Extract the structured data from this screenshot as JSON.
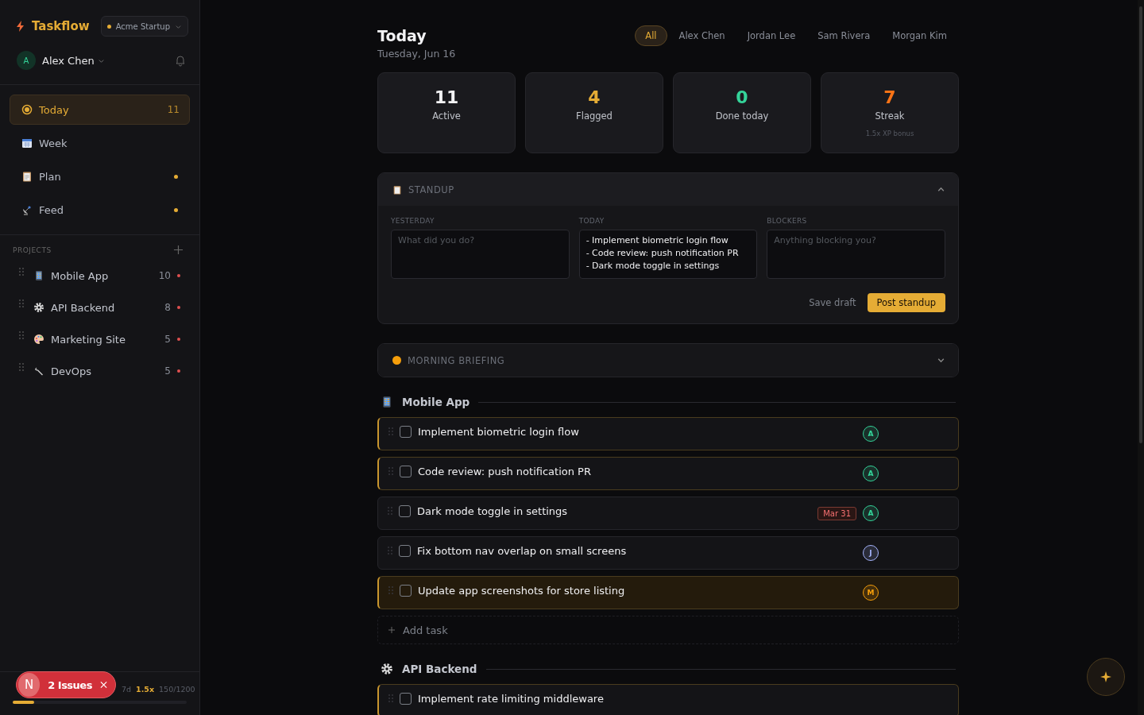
{
  "sidebar": {
    "app_name": "Taskflow",
    "workspace": {
      "name": "Acme Startup"
    },
    "user": {
      "initial": "A",
      "name": "Alex Chen"
    },
    "nav": [
      {
        "kind": "today",
        "label": "Today",
        "count": "11",
        "selected": true,
        "dot": false
      },
      {
        "kind": "week",
        "label": "Week",
        "selected": false,
        "dot": false
      },
      {
        "kind": "plan",
        "label": "Plan",
        "selected": false,
        "dot": true
      },
      {
        "kind": "feed",
        "label": "Feed",
        "selected": false,
        "dot": true
      }
    ],
    "projects_heading": "PROJECTS",
    "projects": [
      {
        "kind": "phone",
        "name": "Mobile App",
        "count": "10"
      },
      {
        "kind": "gear",
        "name": "API Backend",
        "count": "8"
      },
      {
        "kind": "palette",
        "name": "Marketing Site",
        "count": "5"
      },
      {
        "kind": "wrench",
        "name": "DevOps",
        "count": "5"
      }
    ],
    "footer": {
      "days": "7d",
      "multiplier": "1.5x",
      "xp": "150/1200",
      "level": 0.125
    }
  },
  "issues_badge": {
    "initial": "N",
    "label": "2 Issues"
  },
  "header": {
    "title": "Today",
    "date": "Tuesday, Jun 16",
    "filters": [
      {
        "label": "All",
        "selected": true
      },
      {
        "label": "Alex Chen",
        "selected": false
      },
      {
        "label": "Jordan Lee",
        "selected": false
      },
      {
        "label": "Sam Rivera",
        "selected": false
      },
      {
        "label": "Morgan Kim",
        "selected": false
      }
    ]
  },
  "stats": [
    {
      "value": "11",
      "label": "Active",
      "color": "#f2f2f4"
    },
    {
      "value": "4",
      "label": "Flagged",
      "color": "#e5ac35"
    },
    {
      "value": "0",
      "label": "Done today",
      "color": "#34d399"
    },
    {
      "value": "7",
      "label": "Streak",
      "color": "#f97316",
      "note": "1.5x XP bonus"
    }
  ],
  "standup": {
    "title": "STANDUP",
    "expanded": true,
    "fields": [
      {
        "label": "YESTERDAY",
        "placeholder": "What did you do?"
      },
      {
        "label": "TODAY",
        "value": "- Implement biometric login flow\n- Code review: push notification PR\n- Dark mode toggle in settings"
      },
      {
        "label": "BLOCKERS",
        "placeholder": "Anything blocking you?"
      }
    ],
    "save": "Save draft",
    "post": "Post standup"
  },
  "briefing": {
    "title": "MORNING BRIEFING",
    "expanded": false
  },
  "groups": [
    {
      "kind": "phone",
      "name": "Mobile App",
      "add": "Add task",
      "tasks": [
        {
          "title": "Implement biometric login flow",
          "checked": false,
          "flagged": true,
          "highlighted": false,
          "assignee": "A",
          "color": "#34d399"
        },
        {
          "title": "Code review: push notification PR",
          "checked": false,
          "flagged": true,
          "highlighted": false,
          "assignee": "A",
          "color": "#34d399"
        },
        {
          "title": "Dark mode toggle in settings",
          "checked": false,
          "flagged": false,
          "highlighted": false,
          "due": "Mar 31",
          "assignee": "A",
          "color": "#34d399"
        },
        {
          "title": "Fix bottom nav overlap on small screens",
          "checked": false,
          "flagged": false,
          "highlighted": false,
          "assignee": "J",
          "color": "#a5b4fc"
        },
        {
          "title": "Update app screenshots for store listing",
          "checked": false,
          "flagged": true,
          "highlighted": true,
          "assignee": "M",
          "color": "#f59e0b"
        }
      ]
    },
    {
      "kind": "gear",
      "name": "API Backend",
      "tasks": [
        {
          "title": "Implement rate limiting middleware",
          "checked": false,
          "flagged": true,
          "highlighted": false
        }
      ]
    }
  ]
}
